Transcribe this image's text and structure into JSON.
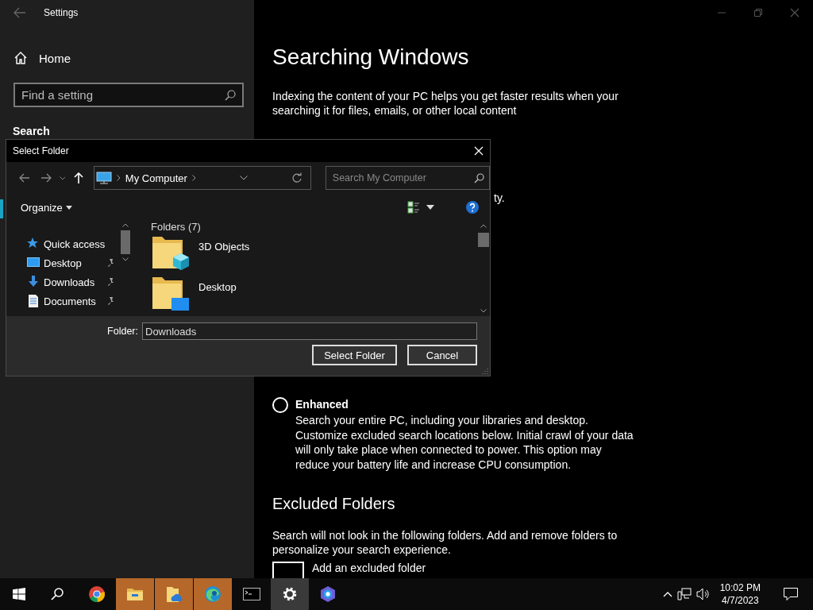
{
  "settings": {
    "window": {
      "title": "Settings"
    },
    "sidebar": {
      "home": "Home",
      "search_placeholder": "Find a setting",
      "section": "Search"
    },
    "main": {
      "title": "Searching Windows",
      "intro": "Indexing the content of your PC helps you get faster results when your searching it for files, emails, or other local content",
      "hidden_text_tail": "ty.",
      "options": [
        {
          "label": "Enhanced",
          "selected": false,
          "description": "Search your entire PC, including your libraries and desktop. Customize excluded search locations below. Initial crawl of your data will only take place when connected to power. This option may reduce your battery life and increase CPU consumption."
        }
      ],
      "excluded": {
        "heading": "Excluded Folders",
        "description": "Search will not look in the following folders. Add and remove folders to personalize your search experience.",
        "add_label": "Add an excluded folder"
      }
    }
  },
  "dialog": {
    "title": "Select Folder",
    "address": "My Computer",
    "search_placeholder": "Search My Computer",
    "organize": "Organize",
    "nav_items": [
      {
        "label": "Quick access",
        "kind": "star",
        "pinned": false
      },
      {
        "label": "Desktop",
        "kind": "desktop",
        "pinned": true
      },
      {
        "label": "Downloads",
        "kind": "download",
        "pinned": true
      },
      {
        "label": "Documents",
        "kind": "document",
        "pinned": true
      }
    ],
    "section": "Folders (7)",
    "folders": [
      {
        "name": "3D Objects",
        "kind": "cube"
      },
      {
        "name": "Desktop",
        "kind": "desktop"
      }
    ],
    "folder_label": "Folder:",
    "folder_value": "Downloads",
    "buttons": [
      "Select Folder",
      "Cancel"
    ]
  },
  "taskbar": {
    "apps": [
      {
        "kind": "chrome",
        "active": false,
        "flashing": false
      },
      {
        "kind": "explorer",
        "active": false,
        "flashing": true
      },
      {
        "kind": "onedrive",
        "active": false,
        "flashing": true
      },
      {
        "kind": "edge",
        "active": false,
        "flashing": true
      },
      {
        "kind": "terminal",
        "active": false,
        "flashing": false
      },
      {
        "kind": "settings",
        "active": true,
        "flashing": false
      },
      {
        "kind": "app",
        "active": false,
        "flashing": false
      }
    ],
    "time": "10:02 PM",
    "date": "4/7/2023"
  }
}
